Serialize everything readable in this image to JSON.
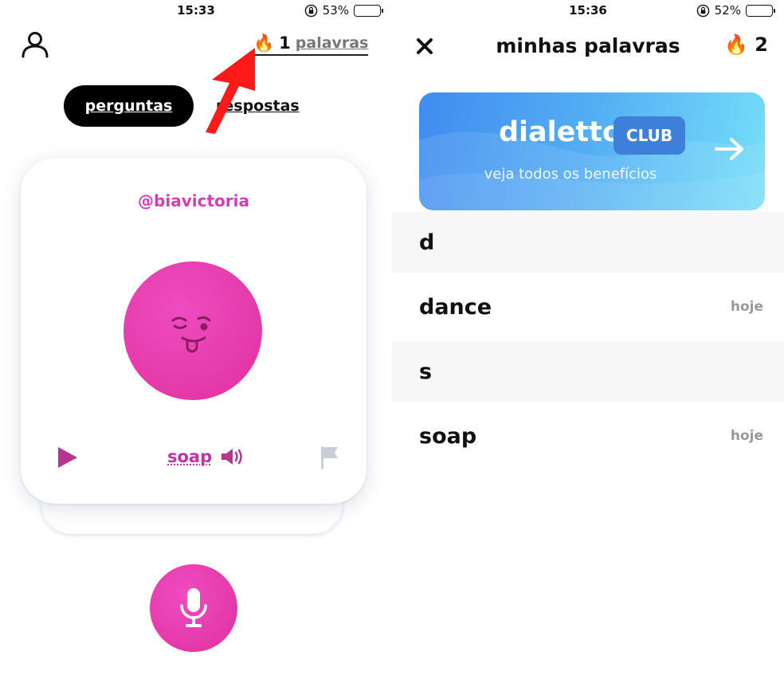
{
  "left": {
    "status": {
      "time": "15:33",
      "battery": "53%",
      "battery_level": 0.53
    },
    "header": {
      "count": "1",
      "words_label": "palavras",
      "fire_icon": "fire-emoji"
    },
    "tabs": [
      {
        "label": "perguntas",
        "active": true
      },
      {
        "label": "respostas",
        "active": false
      }
    ],
    "card": {
      "username": "@biavictoria",
      "word": "soap",
      "emoji_icon": "winking-tongue-face-icon"
    },
    "colors": {
      "accent": "#e0309f",
      "username": "#d43fb0",
      "annotation_arrow": "#ff1a1a"
    }
  },
  "right": {
    "status": {
      "time": "15:36",
      "battery": "52%",
      "battery_level": 0.52
    },
    "header": {
      "title": "minhas palavras",
      "count": "2"
    },
    "banner": {
      "brand": "dialetto",
      "badge": "CLUB",
      "subtitle": "veja todos os benefícios"
    },
    "list": [
      {
        "type": "section",
        "label": "d"
      },
      {
        "type": "item",
        "word": "dance",
        "date": "hoje"
      },
      {
        "type": "section",
        "label": "s"
      },
      {
        "type": "item",
        "word": "soap",
        "date": "hoje"
      }
    ]
  }
}
